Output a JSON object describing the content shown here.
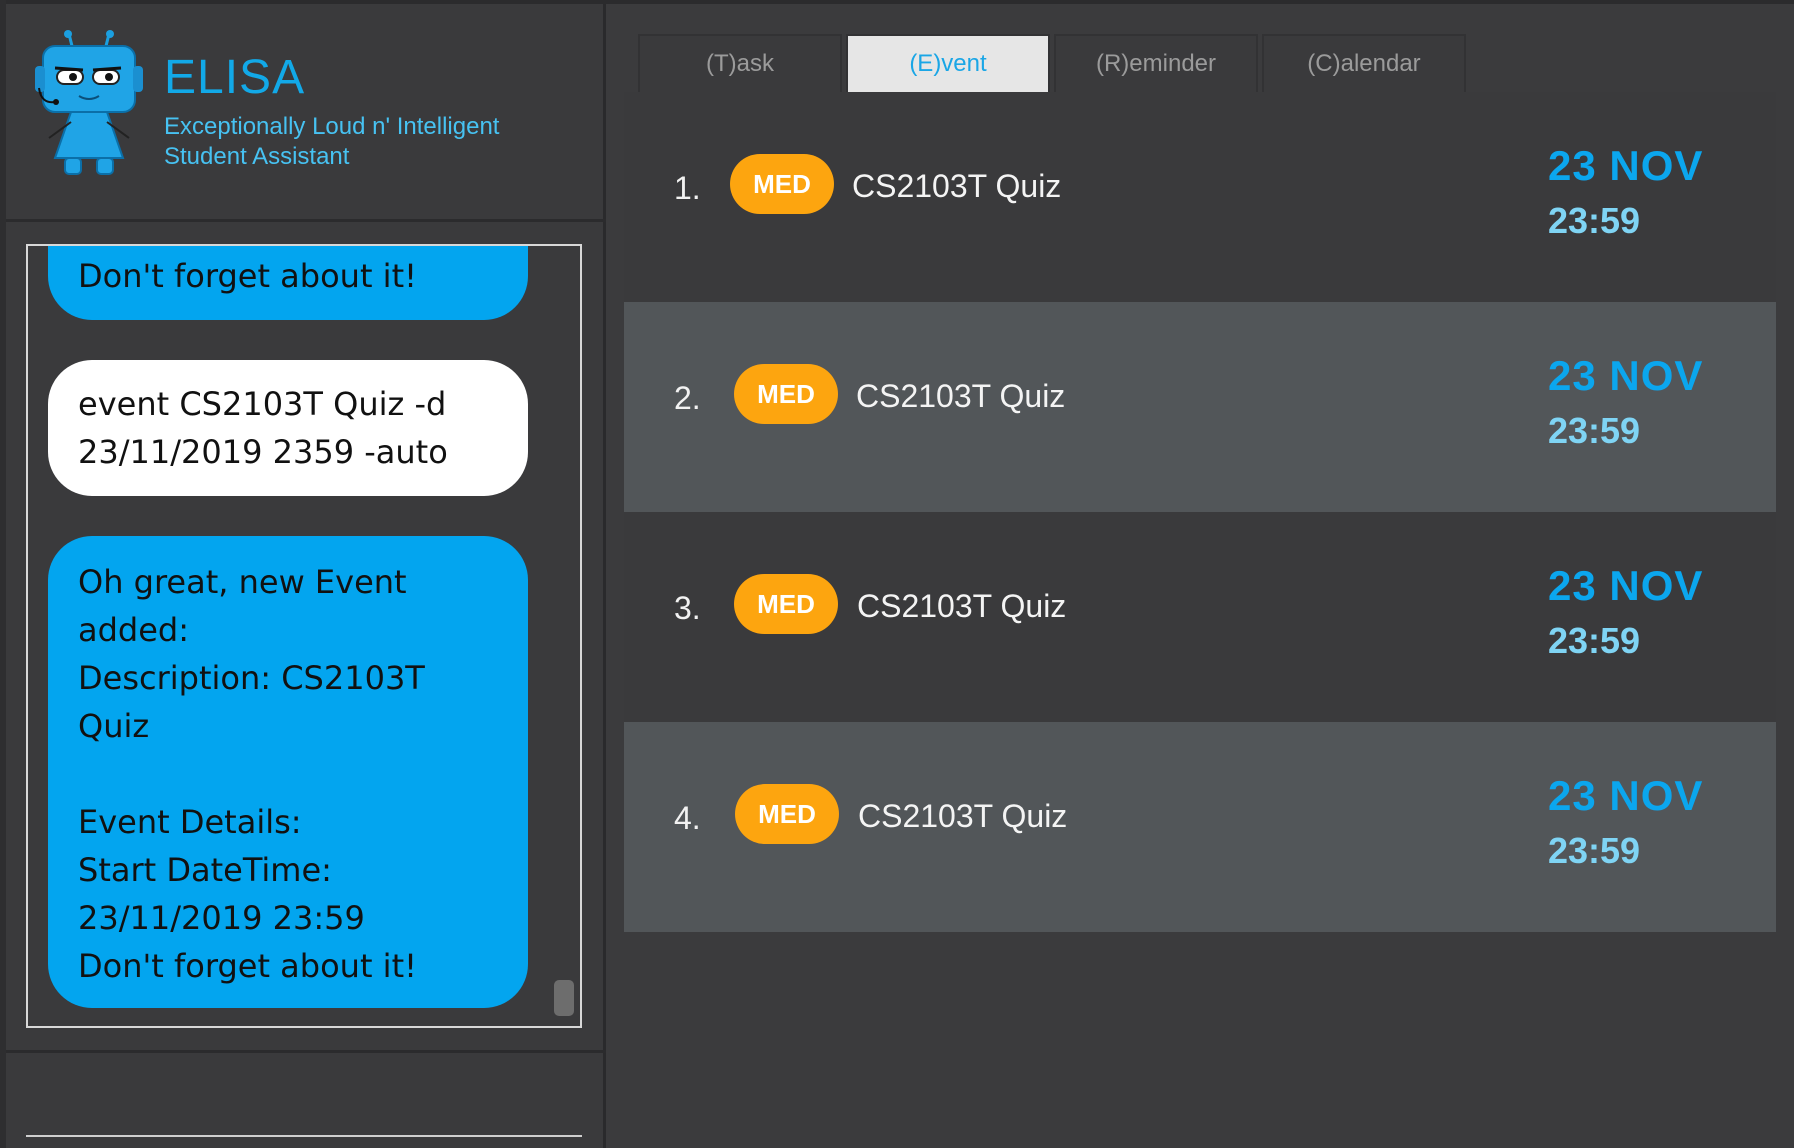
{
  "header": {
    "title": "ELISA",
    "subtitle_line1": "Exceptionally Loud n' Intelligent",
    "subtitle_line2": "Student Assistant"
  },
  "chat": {
    "messages": [
      {
        "sender": "bot",
        "lines": [
          "Don't forget about it!"
        ]
      },
      {
        "sender": "user",
        "lines": [
          "event CS2103T Quiz -d",
          "23/11/2019 2359 -auto"
        ]
      },
      {
        "sender": "bot",
        "lines": [
          "Oh great, new Event",
          "added:",
          "Description: CS2103T",
          "Quiz",
          "",
          "Event Details:",
          "Start DateTime:",
          "23/11/2019 23:59",
          "Don't forget about it!"
        ]
      }
    ]
  },
  "command_box": {
    "value": ""
  },
  "tabs": [
    {
      "label": "(T)ask",
      "active": false
    },
    {
      "label": "(E)vent",
      "active": true
    },
    {
      "label": "(R)eminder",
      "active": false
    },
    {
      "label": "(C)alendar",
      "active": false
    }
  ],
  "events": [
    {
      "index": "1.",
      "priority": "MED",
      "description": "CS2103T Quiz",
      "date": "23 NOV",
      "time": "23:59"
    },
    {
      "index": "2.",
      "priority": "MED",
      "description": "CS2103T Quiz",
      "date": "23 NOV",
      "time": "23:59"
    },
    {
      "index": "3.",
      "priority": "MED",
      "description": "CS2103T Quiz",
      "date": "23 NOV",
      "time": "23:59"
    },
    {
      "index": "4.",
      "priority": "MED",
      "description": "CS2103T Quiz",
      "date": "23 NOV",
      "time": "23:59"
    }
  ],
  "colors": {
    "accent": "#12a9e8",
    "bot_bubble": "#03a5ef",
    "priority_med": "#fda50f",
    "date_text": "#0ba6ee",
    "time_text": "#7fd4f4"
  },
  "icons": {
    "logo": "robot-mascot-icon"
  }
}
